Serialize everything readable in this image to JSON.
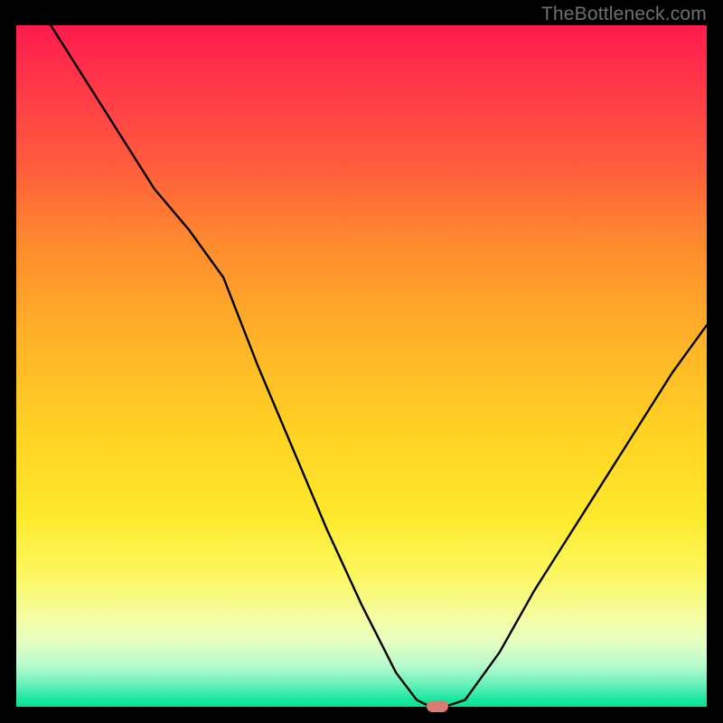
{
  "watermark": "TheBottleneck.com",
  "chart_data": {
    "type": "line",
    "title": "",
    "xlabel": "",
    "ylabel": "",
    "xlim": [
      0,
      100
    ],
    "ylim": [
      0,
      100
    ],
    "grid": false,
    "series": [
      {
        "name": "bottleneck-curve",
        "x": [
          5,
          10,
          15,
          20,
          25,
          30,
          35,
          40,
          45,
          50,
          55,
          58,
          60,
          62,
          65,
          70,
          75,
          80,
          85,
          90,
          95,
          100
        ],
        "y": [
          100,
          92,
          84,
          76,
          70,
          63,
          50,
          38,
          26,
          15,
          5,
          1,
          0,
          0,
          1,
          8,
          17,
          25,
          33,
          41,
          49,
          56
        ]
      }
    ],
    "marker": {
      "x": 61,
      "y": 0,
      "color": "#d77b73"
    },
    "background_gradient": {
      "top": "#ff1a4d",
      "mid": "#ffd323",
      "bottom": "#0ae296"
    }
  }
}
